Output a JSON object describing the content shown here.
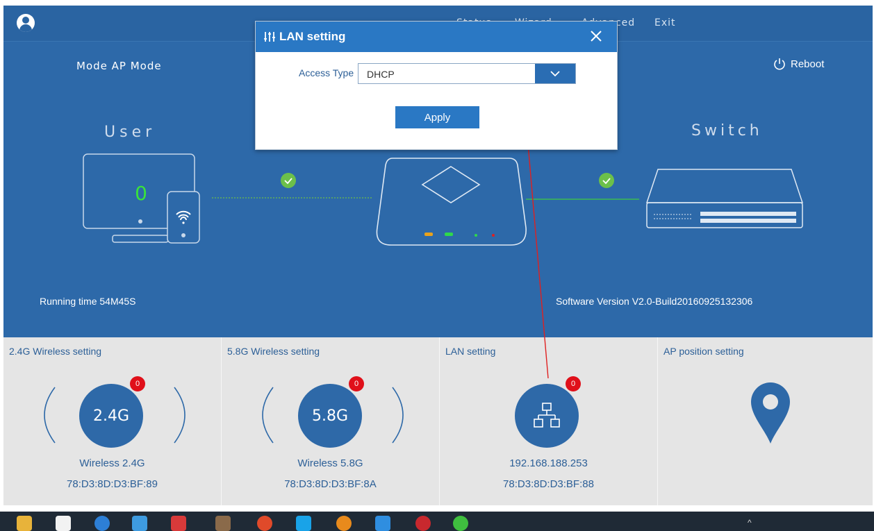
{
  "nav": {
    "status": "Status",
    "wizard": "Wizard",
    "advanced": "Advanced",
    "exit": "Exit"
  },
  "header": {
    "mode": "Mode AP Mode",
    "reboot": "Reboot"
  },
  "topology": {
    "user_title": "User",
    "switch_title": "Switch",
    "user_count": "0"
  },
  "status": {
    "running_time": "Running time 54M45S",
    "software_version": "Software Version V2.0-Build20160925132306"
  },
  "panels": [
    {
      "title": "2.4G Wireless setting",
      "circle_label": "2.4G",
      "badge": "0",
      "line1": "Wireless 2.4G",
      "line2": "78:D3:8D:D3:BF:89"
    },
    {
      "title": "5.8G Wireless setting",
      "circle_label": "5.8G",
      "badge": "0",
      "line1": "Wireless 5.8G",
      "line2": "78:D3:8D:D3:BF:8A"
    },
    {
      "title": "LAN setting",
      "circle_label": "",
      "badge": "0",
      "line1": "192.168.188.253",
      "line2": "78:D3:8D:D3:BF:88"
    },
    {
      "title": "AP position setting",
      "circle_label": "",
      "badge": "",
      "line1": "",
      "line2": ""
    }
  ],
  "modal": {
    "title": "LAN setting",
    "access_type_label": "Access Type",
    "access_type_value": "DHCP",
    "apply": "Apply"
  },
  "colors": {
    "top_bg": "#2d69a9",
    "panel_bg": "#e5e5e5",
    "accent": "#2a78c4",
    "badge": "#e0101a",
    "ok_green": "#6cc04a",
    "arrow_red": "#e02020"
  }
}
